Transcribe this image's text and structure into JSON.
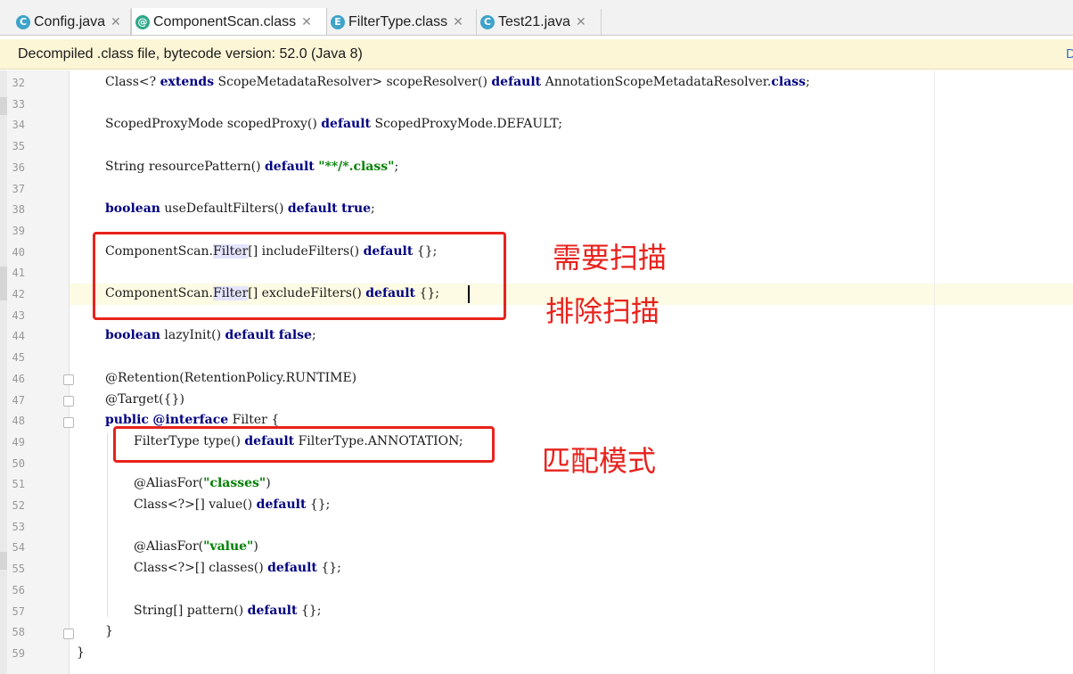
{
  "tabs": [
    {
      "label": "Config.java",
      "icon": "java-class-icon",
      "letter": "C",
      "color": "#3fa3c9",
      "active": false
    },
    {
      "label": "ComponentScan.class",
      "icon": "annotation-icon",
      "letter": "@",
      "color": "#2ea88a",
      "active": true
    },
    {
      "label": "FilterType.class",
      "icon": "enum-icon",
      "letter": "E",
      "color": "#3fa3c9",
      "active": false
    },
    {
      "label": "Test21.java",
      "icon": "java-test-class-icon",
      "letter": "C",
      "color": "#3fa3c9",
      "active": false
    }
  ],
  "tab_close_glyph": "✕",
  "banner": {
    "text": "Decompiled .class file, bytecode version: 52.0 (Java 8)",
    "link_partial": "D"
  },
  "line_numbers": [
    "32",
    "33",
    "34",
    "35",
    "36",
    "37",
    "38",
    "39",
    "40",
    "41",
    "42",
    "43",
    "44",
    "45",
    "46",
    "47",
    "48",
    "49",
    "50",
    "51",
    "52",
    "53",
    "54",
    "55",
    "56",
    "57",
    "58",
    "59"
  ],
  "code_lines": [
    "Class<? extends ScopeMetadataResolver> scopeResolver() default AnnotationScopeMetadataResolver.class;",
    "",
    "ScopedProxyMode scopedProxy() default ScopedProxyMode.DEFAULT;",
    "",
    "String resourcePattern() default \"**/*.class\";",
    "",
    "boolean useDefaultFilters() default true;",
    "",
    "ComponentScan.Filter[] includeFilters() default {};",
    "",
    "ComponentScan.Filter[] excludeFilters() default {};",
    "",
    "boolean lazyInit() default false;",
    "",
    "@Retention(RetentionPolicy.RUNTIME)",
    "@Target({})",
    "public @interface Filter {",
    "FilterType type() default FilterType.ANNOTATION;",
    "",
    "@AliasFor(\"classes\")",
    "Class<?>[] value() default {};",
    "",
    "@AliasFor(\"value\")",
    "Class<?>[] classes() default {};",
    "",
    "String[] pattern() default {};",
    "}",
    "}"
  ],
  "annotations": {
    "include_label": "需要扫描",
    "exclude_label": "排除扫描",
    "match_label": "匹配模式"
  },
  "colors": {
    "keyword": "#000080",
    "string": "#008000",
    "annotation_red": "#e8221c",
    "banner_bg": "#fcf5d6"
  }
}
